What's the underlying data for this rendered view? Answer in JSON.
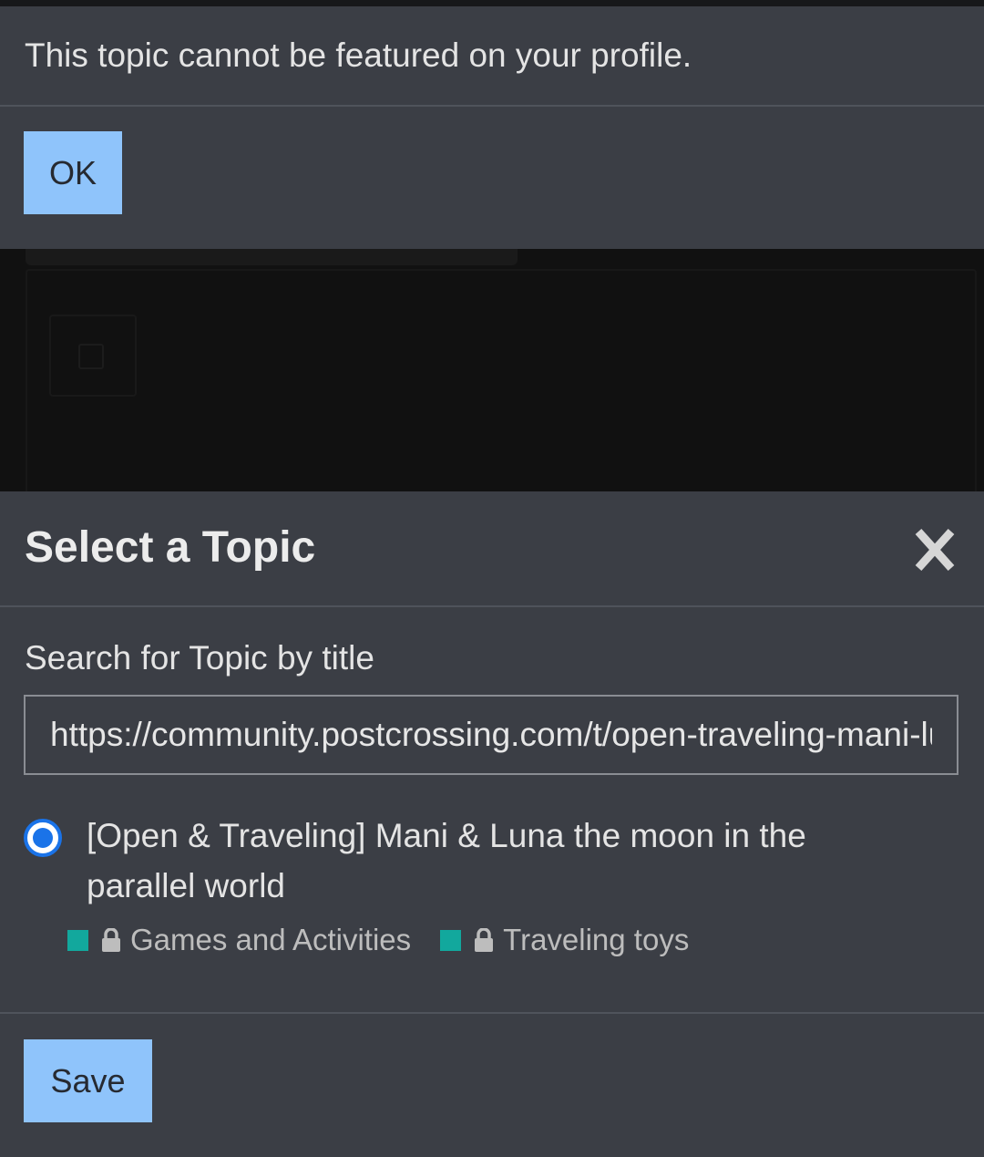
{
  "alert": {
    "message": "This topic cannot be featured on your profile.",
    "ok_label": "OK"
  },
  "modal": {
    "title": "Select a Topic",
    "close_icon": "close-icon",
    "search_label": "Search for Topic by title",
    "search_value": "https://community.postcrossing.com/t/open-traveling-mani-luna-the-moon-in-the-parallel-world",
    "result": {
      "selected": true,
      "title": "[Open & Traveling] Mani & Luna the moon in the parallel world",
      "tags": [
        {
          "label": "Games and Activities",
          "color": "#12a89d",
          "locked": true
        },
        {
          "label": "Traveling toys",
          "color": "#12a89d",
          "locked": true
        }
      ]
    },
    "save_label": "Save"
  },
  "colors": {
    "background": "#3b3e45",
    "primary_button": "#8fc4fb",
    "radio_accent": "#1a73e8"
  }
}
